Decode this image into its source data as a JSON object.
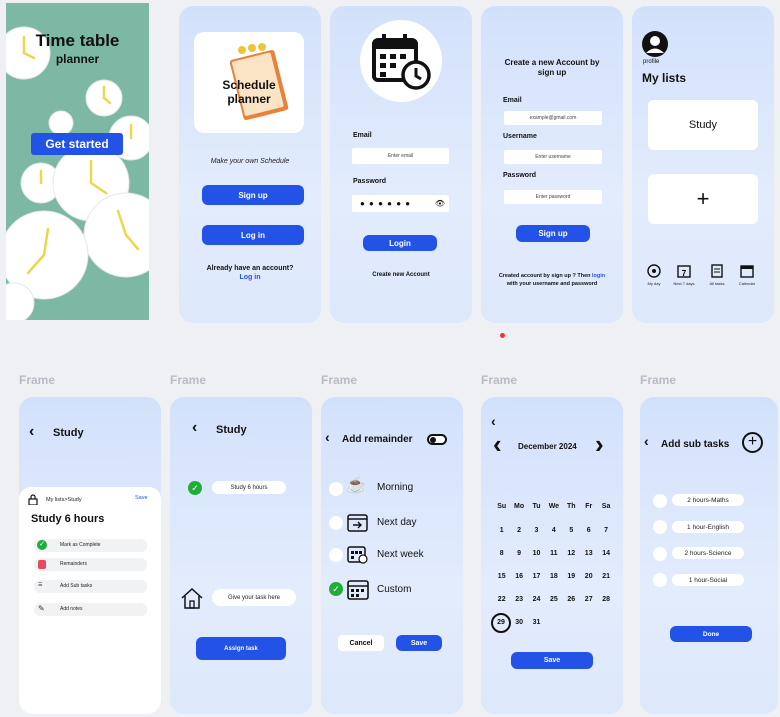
{
  "splash": {
    "title": "Time table",
    "subtitle": "planner",
    "button": "Get started"
  },
  "welcome": {
    "logo_line1": "Schedule",
    "logo_line2": "planner",
    "tagline": "Make your own Schedule",
    "signup": "Sign up",
    "login": "Log in",
    "account_q": "Already have an account?",
    "account_link": "Log in"
  },
  "login": {
    "email_label": "Email",
    "email_placeholder": "Enter email",
    "password_label": "Password",
    "password_dots": "● ● ● ● ● ●",
    "button": "Login",
    "create": "Create new Account"
  },
  "register": {
    "title_line1": "Create a new Account by",
    "title_line2": "sign up",
    "email_label": "Email",
    "email_placeholder": "example@gmail.com",
    "username_label": "Username",
    "username_placeholder": "Enter username",
    "password_label": "Password",
    "password_placeholder": "Enter password",
    "button": "Sign up",
    "note_line1": "Created account by sign up ? Then",
    "note_link": "login",
    "note_line2": "with your username and password"
  },
  "lists": {
    "profile": "profile",
    "title": "My lists",
    "card1": "Study",
    "card2": "+",
    "nav": [
      "My day",
      "Next 7 days",
      "All tasks",
      "Calendar"
    ]
  },
  "frame_label": "Frame",
  "study": {
    "title": "Study",
    "breadcrumb": "My lists>Study",
    "save": "Save",
    "heading": "Study 6 hours",
    "options": [
      "Mark as Complete",
      "Remainders",
      "Add Sub tasks",
      "Add notes"
    ]
  },
  "study2": {
    "title": "Study",
    "task": "Study 6 hours",
    "placeholder": "Give your task here",
    "button": "Assign task"
  },
  "reminder": {
    "title": "Add remainder",
    "options": [
      "Morning",
      "Next day",
      "Next week",
      "Custom"
    ],
    "cancel": "Cancel",
    "save": "Save"
  },
  "calendar": {
    "month": "December",
    "year": "2024",
    "days": [
      "Su",
      "Mo",
      "Tu",
      "We",
      "Th",
      "Fr",
      "Sa"
    ],
    "dates": [
      "1",
      "2",
      "3",
      "4",
      "5",
      "6",
      "7",
      "8",
      "9",
      "10",
      "11",
      "12",
      "13",
      "14",
      "15",
      "16",
      "17",
      "18",
      "19",
      "20",
      "21",
      "22",
      "23",
      "24",
      "25",
      "26",
      "27",
      "28",
      "29",
      "30",
      "31"
    ],
    "selected": "29",
    "save": "Save"
  },
  "subtasks": {
    "title": "Add sub tasks",
    "items": [
      "2 hours-Maths",
      "1 hour-English",
      "2 hours-Science",
      "1 hour-Social"
    ],
    "done": "Done"
  },
  "colors": {
    "accent": "#2352e6",
    "teal": "#78b9a4",
    "check": "#1fae3a"
  }
}
